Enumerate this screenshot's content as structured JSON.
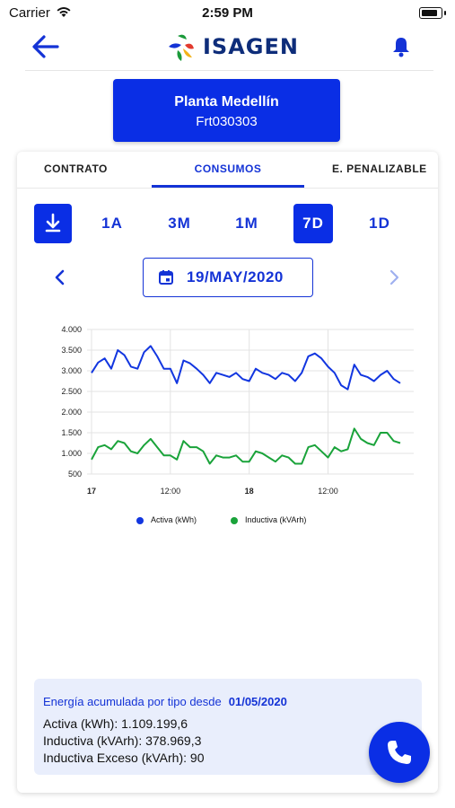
{
  "status_bar": {
    "carrier": "Carrier",
    "time": "2:59 PM"
  },
  "header": {
    "logo_text": "ISAGEN"
  },
  "plant": {
    "name": "Planta Medellín",
    "code": "Frt030303"
  },
  "tabs": [
    {
      "label": "CONTRATO",
      "selected": false
    },
    {
      "label": "CONSUMOS",
      "selected": true
    },
    {
      "label": "E. PENALIZABLE",
      "selected": false
    }
  ],
  "periods": [
    {
      "label": "1A",
      "selected": false
    },
    {
      "label": "3M",
      "selected": false
    },
    {
      "label": "1M",
      "selected": false
    },
    {
      "label": "7D",
      "selected": true
    },
    {
      "label": "1D",
      "selected": false
    }
  ],
  "date": "19/MAY/2020",
  "colors": {
    "accent": "#0a2ee5",
    "series_activa": "#1236e0",
    "series_inductiva": "#1aa33a"
  },
  "chart_data": {
    "type": "line",
    "x": [
      0,
      1,
      2,
      3,
      4,
      5,
      6,
      7,
      8,
      9,
      10,
      11,
      12,
      13,
      14,
      15,
      16,
      17,
      18,
      19,
      20,
      21,
      22,
      23,
      24,
      25,
      26,
      27,
      28,
      29,
      30,
      31,
      32,
      33,
      34,
      35,
      36,
      37,
      38,
      39,
      40,
      41,
      42,
      43,
      44,
      45,
      46,
      47
    ],
    "x_tick_labels": [
      {
        "x": 0,
        "label": "17",
        "bold": true
      },
      {
        "x": 12,
        "label": "12:00",
        "bold": false
      },
      {
        "x": 24,
        "label": "18",
        "bold": true
      },
      {
        "x": 36,
        "label": "12:00",
        "bold": false
      }
    ],
    "y_tick_labels": [
      "4.000",
      "3.500",
      "3.000",
      "2.500",
      "2.000",
      "1.500",
      "1.000",
      "500"
    ],
    "ylim": [
      500,
      4000
    ],
    "grid": true,
    "legend_position": "bottom",
    "series": [
      {
        "name": "Activa (kWh)",
        "color": "#1236e0",
        "values": [
          2950,
          3200,
          3300,
          3050,
          3500,
          3380,
          3100,
          3050,
          3450,
          3600,
          3350,
          3050,
          3050,
          2700,
          3250,
          3180,
          3050,
          2900,
          2700,
          2950,
          2900,
          2850,
          2950,
          2800,
          2750,
          3050,
          2950,
          2900,
          2800,
          2950,
          2900,
          2750,
          2950,
          3350,
          3420,
          3300,
          3100,
          2950,
          2650,
          2550,
          3150,
          2900,
          2850,
          2750,
          2900,
          3000,
          2800,
          2700
        ]
      },
      {
        "name": "Inductiva (kVArh)",
        "color": "#1aa33a",
        "values": [
          850,
          1150,
          1200,
          1100,
          1300,
          1250,
          1050,
          1000,
          1200,
          1350,
          1150,
          950,
          950,
          850,
          1300,
          1150,
          1150,
          1050,
          750,
          950,
          900,
          900,
          950,
          800,
          800,
          1050,
          1000,
          900,
          800,
          950,
          900,
          750,
          750,
          1150,
          1200,
          1050,
          900,
          1150,
          1050,
          1100,
          1600,
          1350,
          1250,
          1200,
          1500,
          1500,
          1300,
          1250
        ]
      }
    ]
  },
  "summary": {
    "title": "Energía acumulada por tipo desde",
    "date": "01/05/2020",
    "lines": [
      "Activa (kWh): 1.109.199,6",
      "Inductiva (kVArh): 378.969,3",
      "Inductiva Exceso (kVArh): 90"
    ]
  }
}
